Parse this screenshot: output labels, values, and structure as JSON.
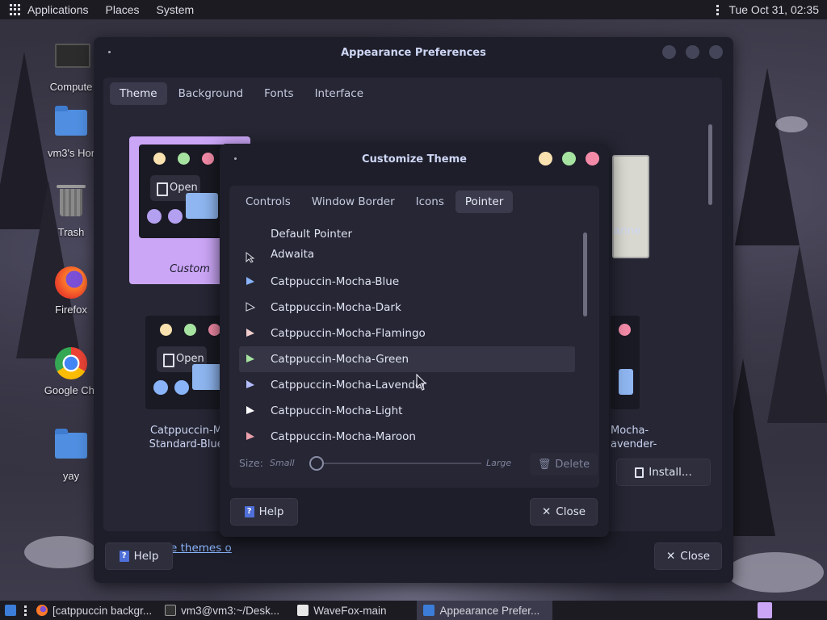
{
  "top_panel": {
    "menus": [
      "Applications",
      "Places",
      "System"
    ],
    "clock": "Tue Oct 31, 02:35"
  },
  "desktop_icons": [
    {
      "label": "Compute",
      "icon": "computer-icon"
    },
    {
      "label": "vm3's Hor",
      "icon": "home-folder-icon"
    },
    {
      "label": "Trash",
      "icon": "trash-icon"
    },
    {
      "label": "Firefox",
      "icon": "firefox-icon"
    },
    {
      "label": "Google Chr",
      "icon": "chrome-icon"
    },
    {
      "label": "yay",
      "icon": "folder-icon"
    }
  ],
  "appearance_window": {
    "title": "Appearance Preferences",
    "tabs": [
      "Theme",
      "Background",
      "Fonts",
      "Interface"
    ],
    "active_tab": "Theme",
    "themes": [
      {
        "label": "Custom",
        "selected": true
      },
      {
        "label": "arine"
      },
      {
        "label": "Catppuccin-Moc\nStandard-Blue-D"
      },
      {
        "label": "Mocha-\navender-"
      }
    ],
    "preview_button_label": "Open",
    "more_link": "Get more themes o",
    "install_button": "Install...",
    "help_button": "Help",
    "close_button": "Close"
  },
  "customize_dialog": {
    "title": "Customize Theme",
    "tabs": [
      "Controls",
      "Window Border",
      "Icons",
      "Pointer"
    ],
    "active_tab": "Pointer",
    "pointers": [
      {
        "name": "Default Pointer",
        "color": ""
      },
      {
        "name": "Adwaita",
        "color": "outline"
      },
      {
        "name": "Catppuccin-Mocha-Blue",
        "color": "#89b4fa"
      },
      {
        "name": "Catppuccin-Mocha-Dark",
        "color": "dark"
      },
      {
        "name": "Catppuccin-Mocha-Flamingo",
        "color": "#f2cdcd"
      },
      {
        "name": "Catppuccin-Mocha-Green",
        "color": "#a6e3a1",
        "selected": true
      },
      {
        "name": "Catppuccin-Mocha-Lavender",
        "color": "#b4befe"
      },
      {
        "name": "Catppuccin-Mocha-Light",
        "color": "#ffffff"
      },
      {
        "name": "Catppuccin-Mocha-Maroon",
        "color": "#eba0ac"
      }
    ],
    "size_label": "Size:",
    "size_small": "Small",
    "size_large": "Large",
    "delete_button": "Delete",
    "help_button": "Help",
    "close_button": "Close"
  },
  "taskbar": {
    "tasks": [
      {
        "label": "[catppuccin backgr...",
        "icon": "firefox-icon"
      },
      {
        "label": "vm3@vm3:~/Desk...",
        "icon": "terminal-icon"
      },
      {
        "label": "WaveFox-main",
        "icon": "folder-icon"
      },
      {
        "label": "Appearance Prefer...",
        "icon": "appearance-icon",
        "active": true
      }
    ]
  },
  "colors": {
    "accent": "#cba6f7",
    "close_red": "#f38ba8",
    "maximize_green": "#a6e3a1",
    "minimize_yellow": "#f9e2af",
    "link": "#89b4fa"
  }
}
